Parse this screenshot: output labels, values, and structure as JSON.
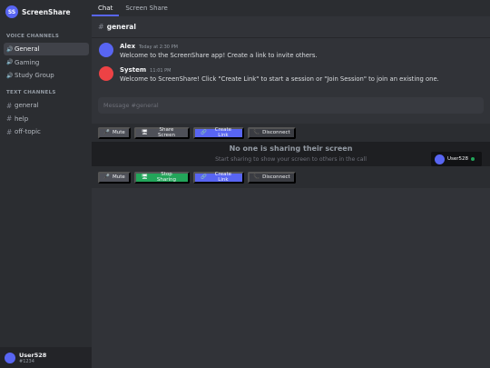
{
  "server": {
    "initials": "SS",
    "name": "ScreenShare"
  },
  "voice_section": {
    "label": "VOICE CHANNELS",
    "items": [
      {
        "label": "General",
        "active": true
      },
      {
        "label": "Gaming"
      },
      {
        "label": "Study Group"
      }
    ]
  },
  "text_section": {
    "label": "TEXT CHANNELS",
    "items": [
      {
        "label": "general"
      },
      {
        "label": "help"
      },
      {
        "label": "off-topic"
      }
    ]
  },
  "user": {
    "name": "User528",
    "tag": "#1234"
  },
  "tabs": [
    {
      "label": "Chat",
      "active": true
    },
    {
      "label": "Screen Share"
    }
  ],
  "channel_header": {
    "name": "general"
  },
  "messages": [
    {
      "author": "Alex",
      "time": "Today at 2:30 PM",
      "text": "Welcome to the ScreenShare app! Create a link to invite others.",
      "avatar_color": "#5865f2"
    },
    {
      "author": "System",
      "time": "11:01 PM",
      "text": "Welcome to ScreenShare! Click \"Create Link\" to start a session or \"Join Session\" to join an existing one.",
      "avatar_color": "#ed4245"
    }
  ],
  "composer": {
    "placeholder": "Message #general"
  },
  "controls_top": {
    "mute": "Mute",
    "share": "Share Screen",
    "create_link": "Create Link",
    "disconnect": "Disconnect"
  },
  "share_panel": {
    "title": "No one is sharing their screen",
    "subtitle": "Start sharing to show your screen to others in the call",
    "self_name": "User528"
  },
  "controls_bottom": {
    "mute": "Mute",
    "stop": "Stop Sharing",
    "create_link": "Create Link",
    "disconnect": "Disconnect"
  },
  "colors": {
    "accent": "#5865f2",
    "success": "#23a55a",
    "danger": "#ed4245"
  }
}
